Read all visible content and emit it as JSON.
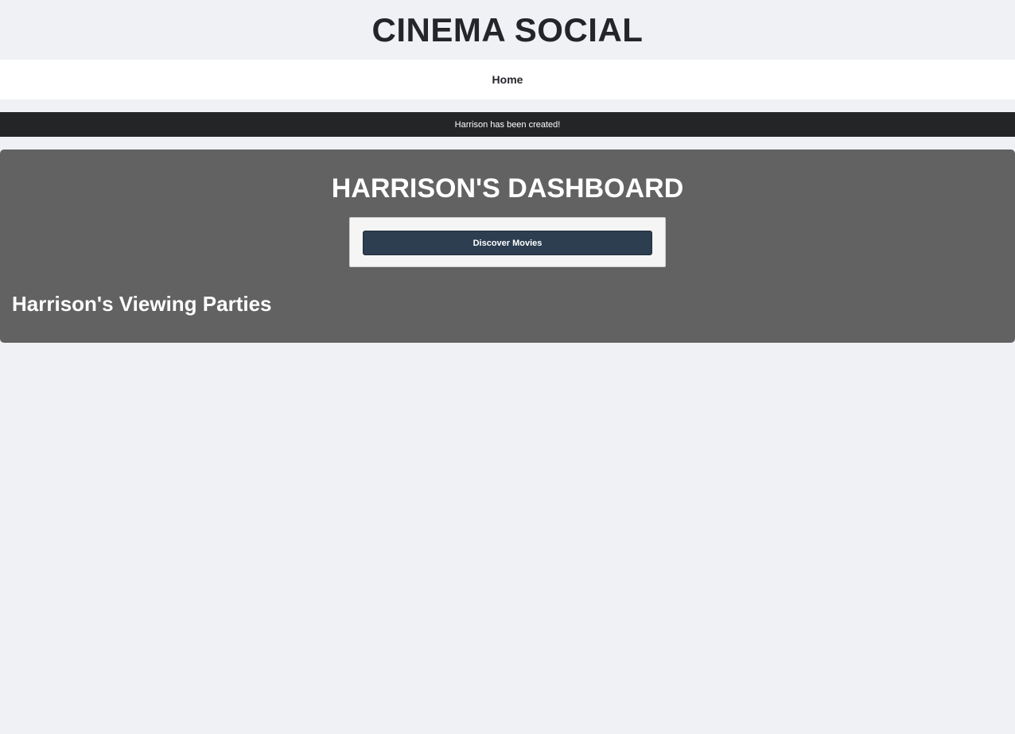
{
  "header": {
    "site_title": "CINEMA SOCIAL"
  },
  "nav": {
    "home_label": "Home"
  },
  "flash": {
    "message": "Harrison has been created!"
  },
  "dashboard": {
    "title": "HARRISON'S DASHBOARD",
    "discover_button_label": "Discover Movies",
    "parties_heading": "Harrison's Viewing Parties"
  },
  "colors": {
    "page_background": "#f0f1f5",
    "flash_background": "#232527",
    "dashboard_background": "#626262",
    "button_background": "#2c3e50"
  }
}
